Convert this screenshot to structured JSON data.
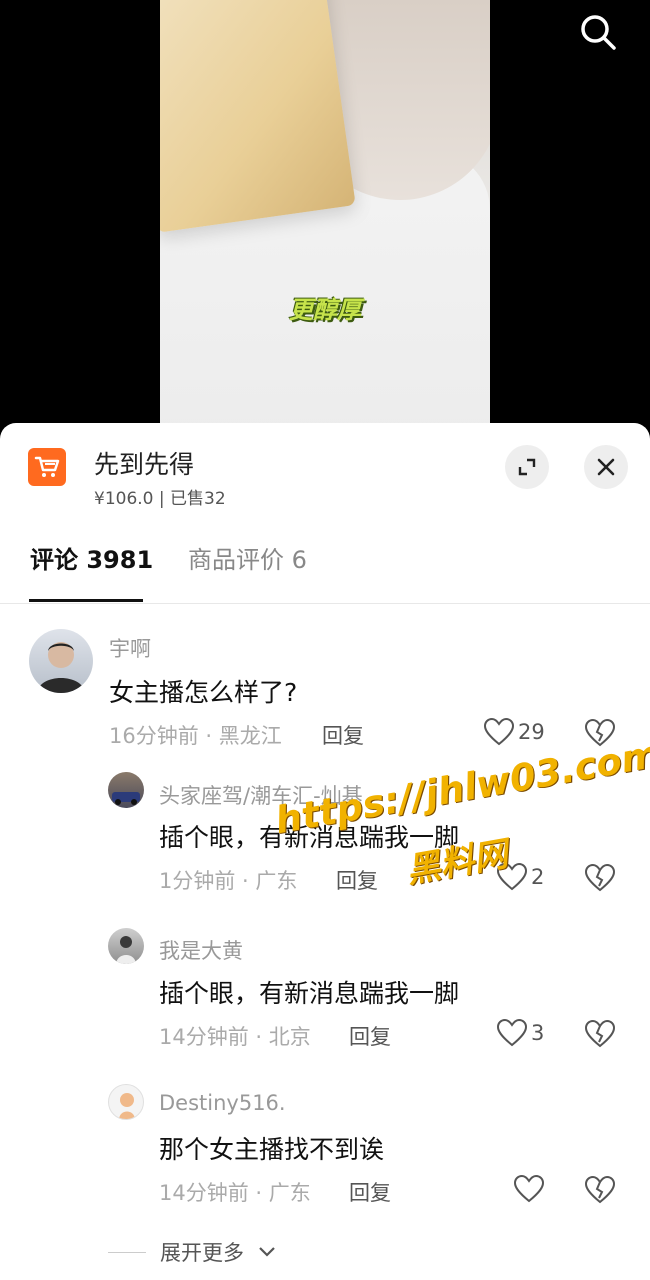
{
  "video": {
    "caption": "更醇厚"
  },
  "product": {
    "title": "先到先得",
    "meta": "¥106.0 | 已售32"
  },
  "tabs": {
    "comments": "评论 3981",
    "reviews": "商品评价 6"
  },
  "comments": [
    {
      "user": "宇啊",
      "text": "女主播怎么样了?",
      "meta": "16分钟前 · 黑龙江",
      "reply": "回复",
      "likes": "29"
    },
    {
      "user": "头家座驾/潮车汇-灿基",
      "text": "插个眼，有新消息踹我一脚",
      "meta": "1分钟前 · 广东",
      "reply": "回复",
      "likes": "2"
    },
    {
      "user": "我是大黄",
      "text": "插个眼，有新消息踹我一脚",
      "meta": "14分钟前 · 北京",
      "reply": "回复",
      "likes": "3"
    },
    {
      "user": "Destiny516.",
      "text": "那个女主播找不到诶",
      "meta": "14分钟前 · 广东",
      "reply": "回复",
      "likes": ""
    }
  ],
  "expand_more": "展开更多",
  "watermark": {
    "line1": "https://jhlw03.com",
    "line2": "黑料网"
  },
  "colors": {
    "accent": "#ff6a1f",
    "caption": "#c6e34b",
    "watermark": "#f1b200"
  },
  "icons": {
    "search": "search-icon",
    "cart": "cart-icon",
    "expand": "expand-icon",
    "close": "close-icon",
    "like": "heart-icon",
    "dislike": "broken-heart-icon"
  }
}
